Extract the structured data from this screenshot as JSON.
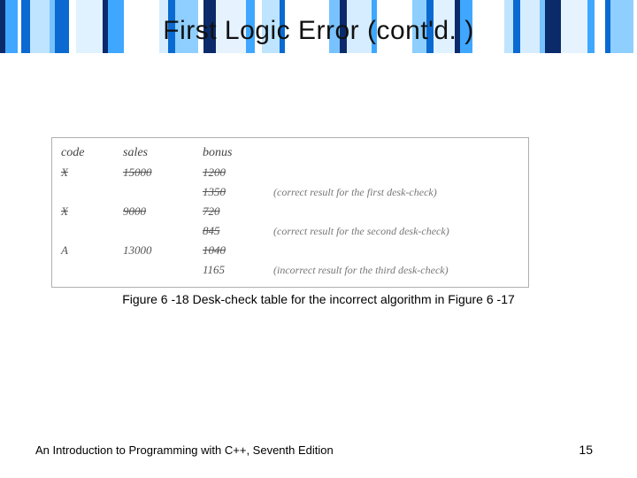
{
  "title": "First Logic Error (cont'd. )",
  "table": {
    "headers": {
      "code": "code",
      "sales": "sales",
      "bonus": "bonus"
    },
    "rows": [
      {
        "code": "X",
        "code_strike": true,
        "sales": "15000",
        "sales_strike": true,
        "bonus": "1200",
        "bonus_strike": true,
        "note": ""
      },
      {
        "code": "",
        "sales": "",
        "bonus": "1350",
        "bonus_strike": true,
        "note": "(correct result for the first desk-check)"
      },
      {
        "code": "X",
        "code_strike": true,
        "sales": "9000",
        "sales_strike": true,
        "bonus": "720",
        "bonus_strike": true,
        "note": ""
      },
      {
        "code": "",
        "sales": "",
        "bonus": "845",
        "bonus_strike": true,
        "note": "(correct result for the second desk-check)"
      },
      {
        "code": "A",
        "code_strike": false,
        "sales": "13000",
        "sales_strike": false,
        "bonus": "1040",
        "bonus_strike": true,
        "note": ""
      },
      {
        "code": "",
        "sales": "",
        "bonus": "1165",
        "bonus_strike": false,
        "note": "(incorrect result for the third desk-check)"
      }
    ]
  },
  "caption": "Figure 6 -18 Desk-check table for the incorrect algorithm in Figure 6 -17",
  "footer_left": "An Introduction to Programming with C++, Seventh Edition",
  "footer_right": "15",
  "colors": {
    "bar_palette": [
      "#0a2a6a",
      "#3fa7ff",
      "#0a6ad1",
      "#bfe4ff",
      "#78c2ff",
      "#0a6ad1",
      "#e0f1ff",
      "#0a2a6a",
      "#3fa7ff",
      "#d6edff",
      "#0a6ad1",
      "#8fcfff",
      "#0a2a6a",
      "#3fa7ff",
      "#e6f3ff"
    ]
  }
}
